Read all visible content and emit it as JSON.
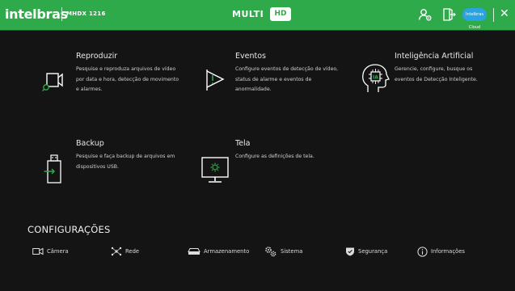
{
  "header": {
    "brand": "intelbras",
    "model": "MHDX 1216",
    "product_prefix": "MULTI",
    "product_badge": "HD",
    "cloud_label": "Intelbras Cloud",
    "close_symbol": "✕",
    "brand_color": "#2faa4a"
  },
  "modules": [
    {
      "title": "Reproduzir",
      "description": "Pesquise e reproduza arquivos de vídeo por data e hora, detecção de movimento e alarmes.",
      "icon": "playback-icon"
    },
    {
      "title": "Eventos",
      "description": "Configure eventos de detecção de vídeo, status de alarme e eventos de anormalidade.",
      "icon": "events-flag-icon"
    },
    {
      "title": "Inteligência Artificial",
      "description": "Gerencie, configure, busque os eventos de Detecção Inteligente.",
      "icon": "ai-head-icon"
    },
    {
      "title": "Backup",
      "description": "Pesquise e faça backup de arquivos em dispositivos USB.",
      "icon": "usb-backup-icon"
    },
    {
      "title": "Tela",
      "description": "Configure as definições de tela.",
      "icon": "display-settings-icon"
    }
  ],
  "config": {
    "title": "CONFIGURAÇÕES",
    "items": [
      {
        "label": "Câmera",
        "icon": "camera-icon"
      },
      {
        "label": "Rede",
        "icon": "network-icon"
      },
      {
        "label": "Armazenamento",
        "icon": "storage-icon"
      },
      {
        "label": "Sistema",
        "icon": "gears-icon"
      },
      {
        "label": "Segurança",
        "icon": "shield-icon"
      },
      {
        "label": "Informações",
        "icon": "info-icon"
      }
    ]
  }
}
